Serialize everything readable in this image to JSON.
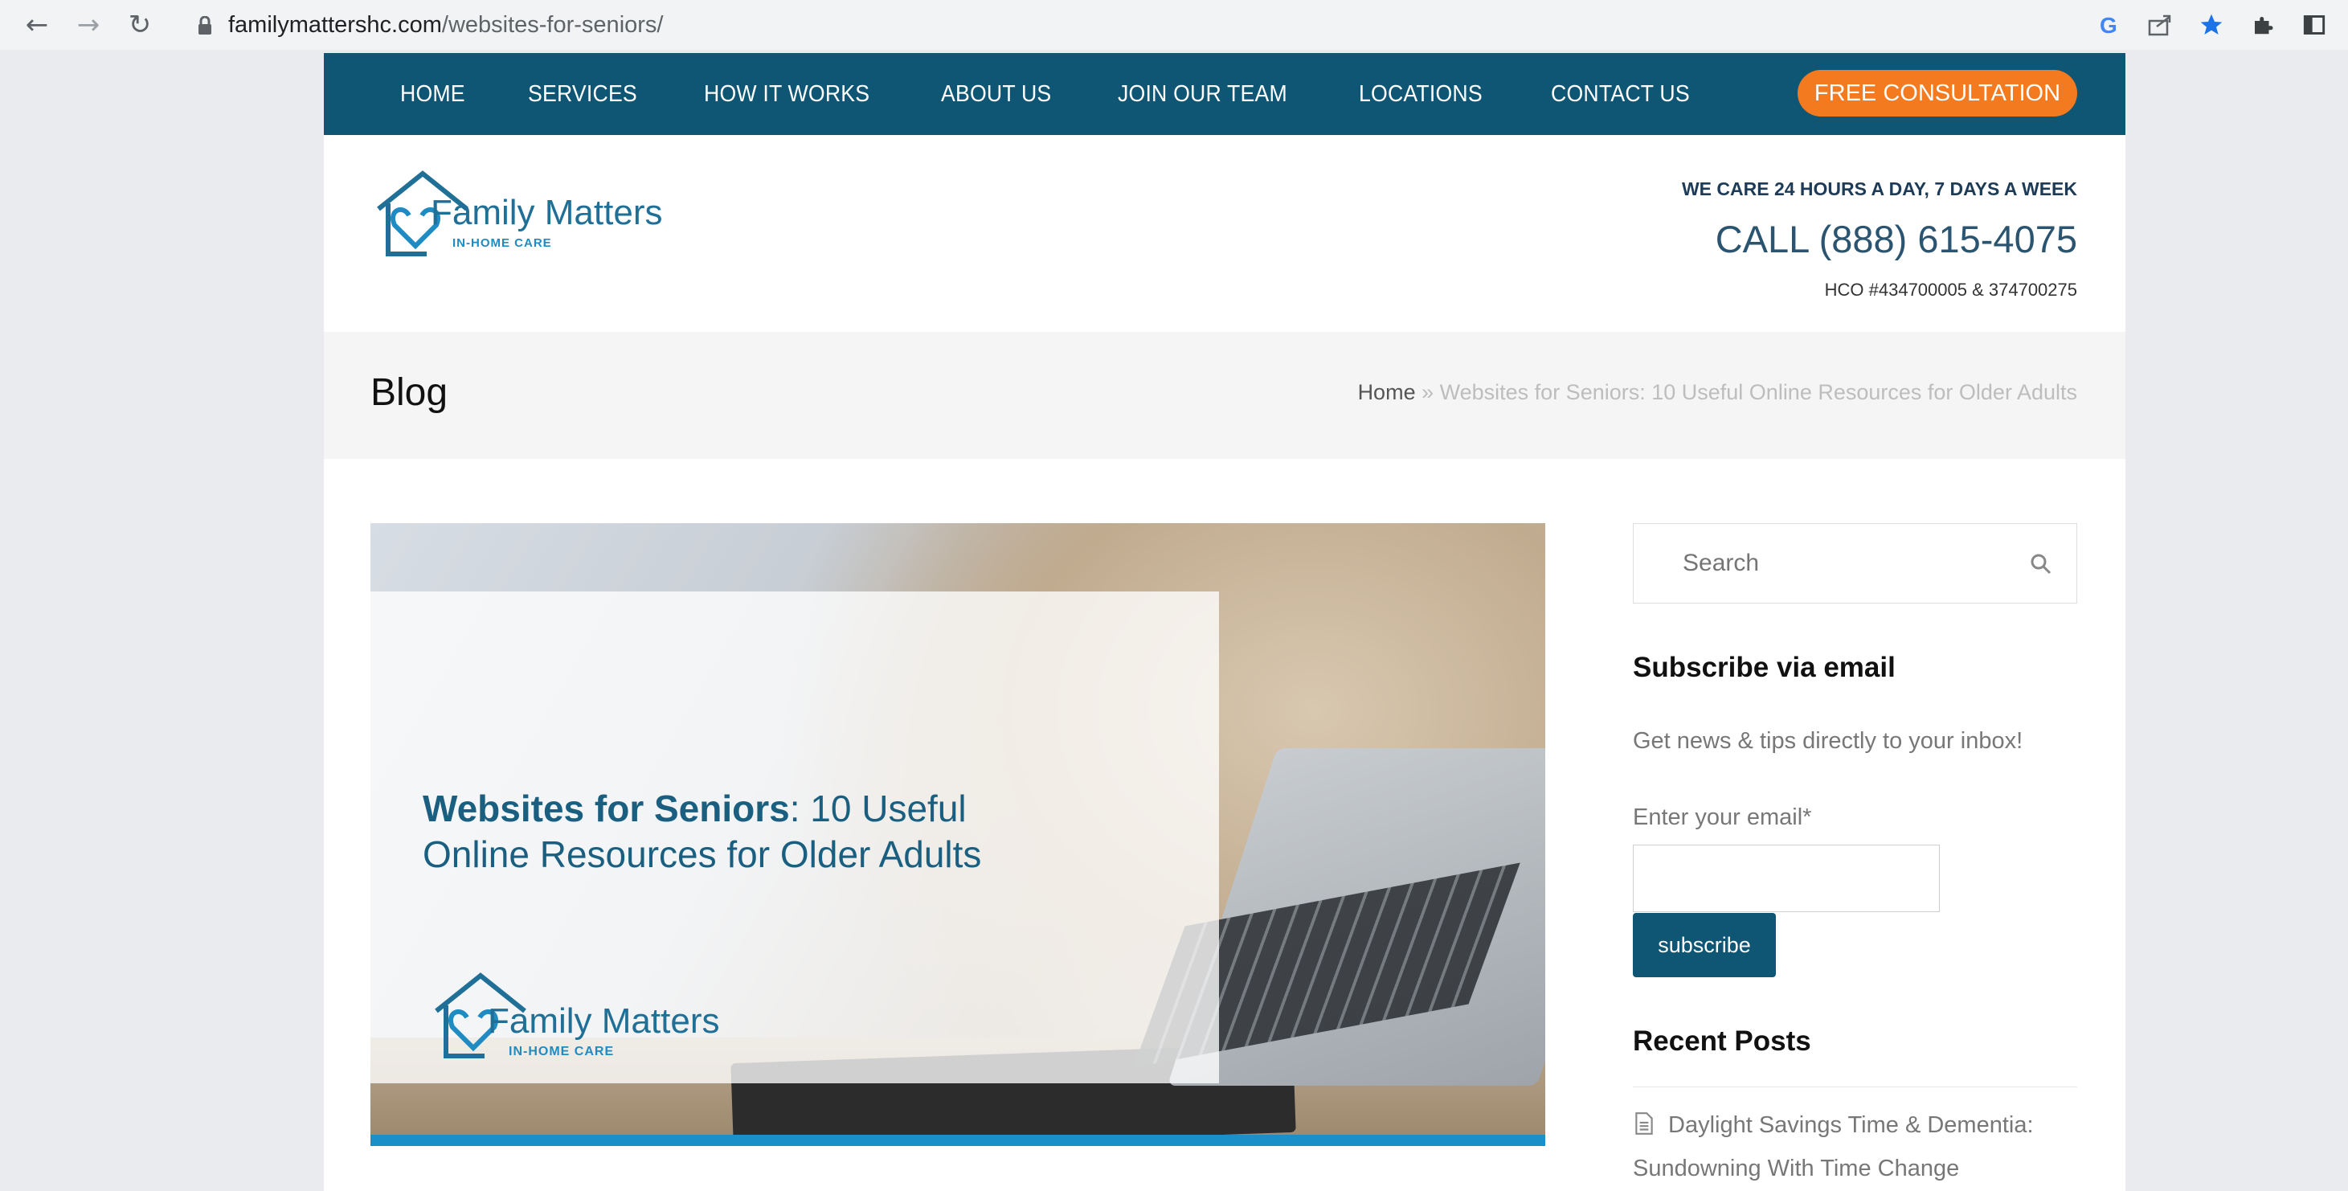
{
  "browser": {
    "url_domain": "familymattershc.com",
    "url_path": "/websites-for-seniors/",
    "icons": [
      "back-arrow-icon",
      "forward-arrow-icon",
      "reload-icon",
      "lock-icon",
      "google-icon",
      "share-icon",
      "star-icon",
      "extensions-puzzle-icon",
      "sidebar-icon"
    ]
  },
  "topnav": {
    "items": [
      "HOME",
      "SERVICES",
      "HOW IT WORKS",
      "ABOUT US",
      "JOIN OUR TEAM",
      "LOCATIONS",
      "CONTACT US"
    ],
    "cta": "FREE CONSULTATION"
  },
  "header": {
    "logo_name": "Family Matters",
    "logo_sub": "IN-HOME CARE",
    "care_line": "WE CARE 24 HOURS A DAY, 7 DAYS A WEEK",
    "phone": "CALL (888) 615-4075",
    "hco": "HCO #434700005 & 374700275"
  },
  "band": {
    "title": "Blog",
    "breadcrumb_home": "Home",
    "breadcrumb_sep": " » ",
    "breadcrumb_current": "Websites for Seniors: 10 Useful Online Resources for Older Adults"
  },
  "hero": {
    "title_bold": "Websites for Seniors",
    "title_rest": ": 10 Useful",
    "title_line2": "Online Resources for Older Adults",
    "logo_name": "Family Matters",
    "logo_sub": "IN-HOME CARE"
  },
  "sidebar": {
    "search_placeholder": "Search",
    "subscribe_heading": "Subscribe via email",
    "subscribe_text": "Get news & tips directly to your inbox!",
    "email_label": "Enter your email*",
    "email_value": "",
    "subscribe_button": "subscribe",
    "recent_heading": "Recent Posts",
    "recent_posts": [
      "Daylight Savings Time & Dementia: Sundowning With Time Change"
    ]
  },
  "colors": {
    "nav_bg": "#0f5675",
    "cta_bg": "#f47a20",
    "brand_blue": "#1f6f96",
    "accent_bar": "#1b8fc7"
  }
}
